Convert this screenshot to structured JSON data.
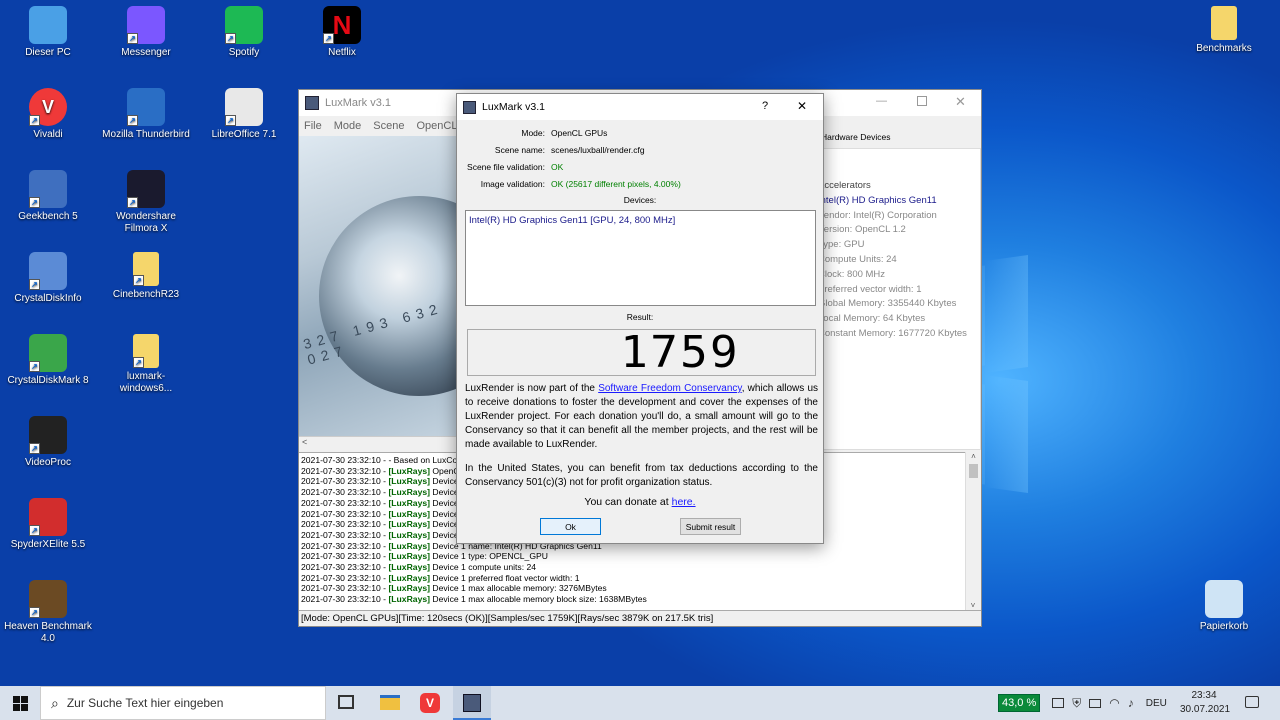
{
  "desktop_icons": [
    {
      "label": "Dieser PC",
      "icon": "pc-icon",
      "color": "#4aa0e6"
    },
    {
      "label": "Messenger",
      "icon": "messenger-icon",
      "color": "#7b57ff"
    },
    {
      "label": "Spotify",
      "icon": "spotify-icon",
      "color": "#1db954"
    },
    {
      "label": "Netflix",
      "icon": "netflix-icon",
      "color": "#000000"
    },
    {
      "label": "Vivaldi",
      "icon": "vivaldi-icon",
      "color": "#ef3939"
    },
    {
      "label": "Mozilla Thunderbird",
      "icon": "thunderbird-icon",
      "color": "#2a6ec5"
    },
    {
      "label": "LibreOffice 7.1",
      "icon": "libreoffice-icon",
      "color": "#e8e8e8"
    },
    {
      "label": "Geekbench 5",
      "icon": "geekbench-icon",
      "color": "#3f6fbf"
    },
    {
      "label": "Wondershare Filmora X",
      "icon": "filmora-icon",
      "color": "#1a1a2e"
    },
    {
      "label": "CrystalDiskInfo",
      "icon": "crystaldiskinfo-icon",
      "color": "#5b8bd6"
    },
    {
      "label": "CinebenchR23",
      "icon": "folder-icon",
      "color": "#f5d66b"
    },
    {
      "label": "CrystalDiskMark 8",
      "icon": "crystaldiskmark-icon",
      "color": "#3aa64a"
    },
    {
      "label": "luxmark-windows6...",
      "icon": "folder-icon",
      "color": "#f5d66b"
    },
    {
      "label": "VideoProc",
      "icon": "videoproc-icon",
      "color": "#222222"
    },
    {
      "label": "SpyderXElite 5.5",
      "icon": "spyder-icon",
      "color": "#d22d2d"
    },
    {
      "label": "Heaven Benchmark 4.0",
      "icon": "heaven-icon",
      "color": "#6b4a23"
    },
    {
      "label": "Benchmarks",
      "icon": "folder-icon",
      "color": "#f5d66b"
    },
    {
      "label": "Papierkorb",
      "icon": "recycle-bin-icon",
      "color": "#cfe4f5"
    }
  ],
  "main_window": {
    "title": "LuxMark v3.1",
    "menu": [
      "File",
      "Mode",
      "Scene",
      "OpenCL Co"
    ],
    "tab": "Hardware Devices",
    "hw_lines": [
      "Accelerators",
      "Intel(R) HD Graphics Gen11",
      "Vendor: Intel(R) Corporation",
      "Version: OpenCL 1.2",
      "Type: GPU",
      "Compute Units: 24",
      "Clock: 800 MHz",
      "Preferred vector width: 1",
      "Global Memory: 3355440 Kbytes",
      "Local Memory: 64 Kbytes",
      "Constant Memory: 1677720 Kbytes"
    ],
    "log": [
      {
        "ts": "2021-07-30 23:32:10",
        "tag": "",
        "msg": "- Based on LuxCore"
      },
      {
        "ts": "2021-07-30 23:32:10",
        "tag": "[LuxRays]",
        "msg": "OpenCL Platform 0: Intel(R) Corporation"
      },
      {
        "ts": "2021-07-30 23:32:10",
        "tag": "[LuxRays]",
        "msg": "Device 0 name: NativeThread"
      },
      {
        "ts": "2021-07-30 23:32:10",
        "tag": "[LuxRays]",
        "msg": "Device 0 type: NATIVE_THREAD"
      },
      {
        "ts": "2021-07-30 23:32:10",
        "tag": "[LuxRays]",
        "msg": "Device 0 compute units: 1"
      },
      {
        "ts": "2021-07-30 23:32:10",
        "tag": "[LuxRays]",
        "msg": "Device 0 preferred float vector width: 4"
      },
      {
        "ts": "2021-07-30 23:32:10",
        "tag": "[LuxRays]",
        "msg": "Device 0 max allocable memory: 0MBytes"
      },
      {
        "ts": "2021-07-30 23:32:10",
        "tag": "[LuxRays]",
        "msg": "Device 0 max allocable memory block size: 0MBytes"
      },
      {
        "ts": "2021-07-30 23:32:10",
        "tag": "[LuxRays]",
        "msg": "Device 1 name: Intel(R) HD Graphics Gen11"
      },
      {
        "ts": "2021-07-30 23:32:10",
        "tag": "[LuxRays]",
        "msg": "Device 1 type: OPENCL_GPU"
      },
      {
        "ts": "2021-07-30 23:32:10",
        "tag": "[LuxRays]",
        "msg": "Device 1 compute units: 24"
      },
      {
        "ts": "2021-07-30 23:32:10",
        "tag": "[LuxRays]",
        "msg": "Device 1 preferred float vector width: 1"
      },
      {
        "ts": "2021-07-30 23:32:10",
        "tag": "[LuxRays]",
        "msg": "Device 1 max allocable memory: 3276MBytes"
      },
      {
        "ts": "2021-07-30 23:32:10",
        "tag": "[LuxRays]",
        "msg": "Device 1 max allocable memory block size: 1638MBytes"
      }
    ],
    "status": "[Mode: OpenCL GPUs][Time: 120secs (OK)][Samples/sec   1759K][Rays/sec   3879K on 217.5K tris]"
  },
  "dialog": {
    "title": "LuxMark v3.1",
    "help": "?",
    "close": "✕",
    "fields": [
      {
        "k": "Mode:",
        "v": "OpenCL GPUs",
        "ok": false
      },
      {
        "k": "Scene name:",
        "v": "scenes/luxball/render.cfg",
        "ok": false
      },
      {
        "k": "Scene file validation:",
        "v": "OK",
        "ok": true
      },
      {
        "k": "Image validation:",
        "v": "OK (25617 different pixels, 4.00%)",
        "ok": true
      }
    ],
    "devices_label": "Devices:",
    "device": "Intel(R) HD Graphics Gen11 [GPU, 24, 800 MHz]",
    "result_label": "Result:",
    "result": "1759",
    "p1_pre": "LuxRender is now part of the ",
    "p1_link": "Software Freedom Conservancy",
    "p1_post": ", which allows us to receive donations to foster the development and cover the expenses of the LuxRender project. For each donation you'll do, a small amount will go to the Conservancy so that it can benefit all the member projects, and the rest will be made available to LuxRender.",
    "p2": "In the United States, you can benefit from tax deductions according to the Conservancy 501(c)(3) not for profit organization status.",
    "donate_pre": "You can donate at ",
    "donate_link": "here.",
    "ok_btn": "Ok",
    "submit_btn": "Submit result"
  },
  "taskbar": {
    "search_placeholder": "Zur Suche Text hier eingeben",
    "battery": "43,0 %",
    "lang": "DEU",
    "time": "23:34",
    "date": "30.07.2021"
  }
}
